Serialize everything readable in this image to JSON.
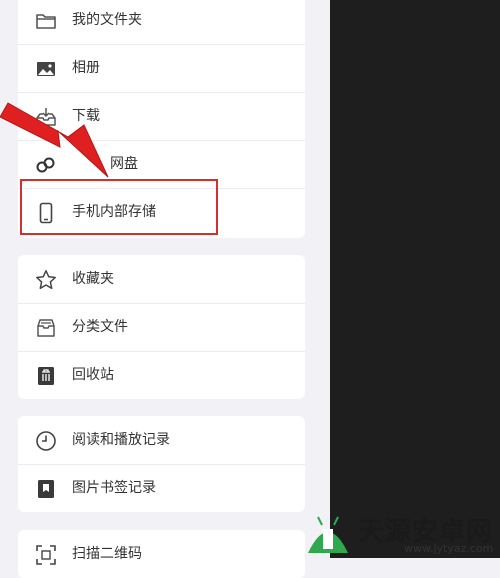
{
  "menu": {
    "group1": [
      {
        "icon": "folder-icon",
        "label": "我的文件夹"
      },
      {
        "icon": "album-icon",
        "label": "相册"
      },
      {
        "icon": "download-icon",
        "label": "下载"
      },
      {
        "icon": "cloud-disk-icon",
        "label": "网盘"
      },
      {
        "icon": "phone-icon",
        "label": "手机内部存储"
      }
    ],
    "group2": [
      {
        "icon": "star-icon",
        "label": "收藏夹"
      },
      {
        "icon": "category-icon",
        "label": "分类文件"
      },
      {
        "icon": "trash-icon",
        "label": "回收站"
      }
    ],
    "group3": [
      {
        "icon": "clock-icon",
        "label": "阅读和播放记录"
      },
      {
        "icon": "bookmark-icon",
        "label": "图片书签记录"
      }
    ],
    "group4": [
      {
        "icon": "qr-scan-icon",
        "label": "扫描二维码"
      }
    ]
  },
  "watermark": {
    "logo": "天源安卓网",
    "url": "www.jytyaz.com"
  },
  "colors": {
    "highlight": "#d32f2f",
    "arrow": "#e02020",
    "dark_panel": "#1e1e1e"
  }
}
